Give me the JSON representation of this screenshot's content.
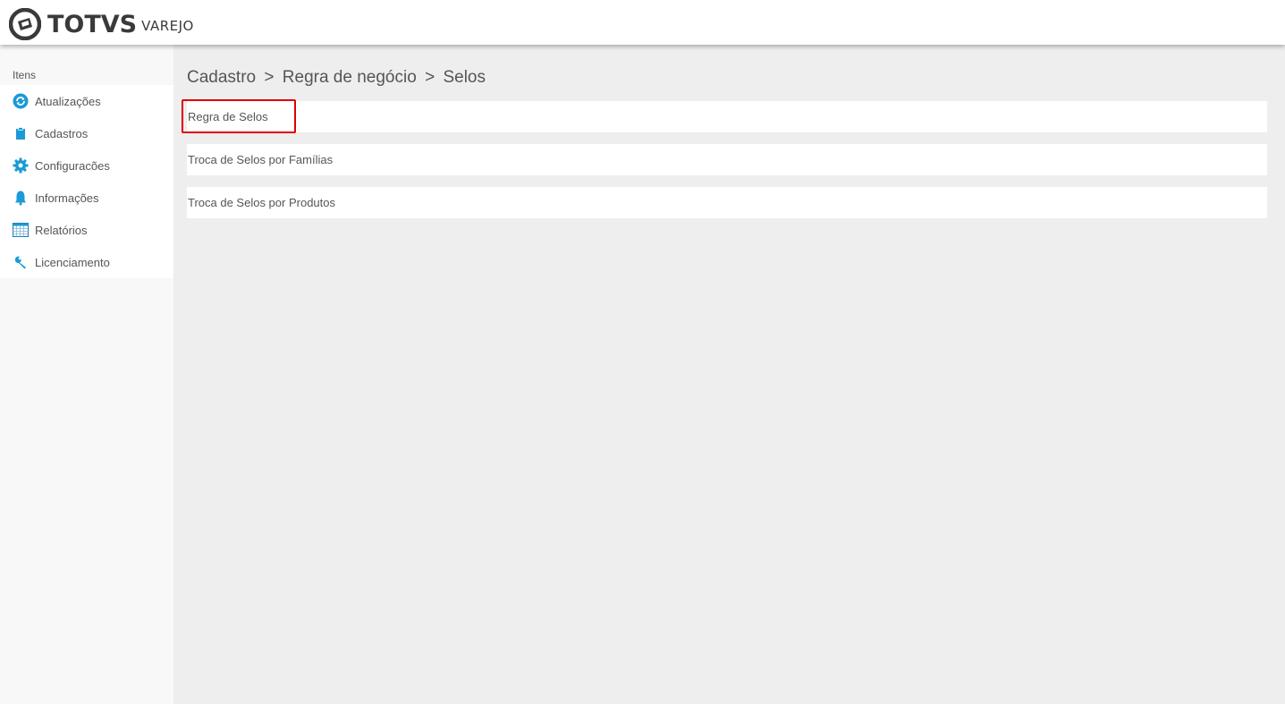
{
  "header": {
    "brand": "TOTVS",
    "product": "VAREJO"
  },
  "sidebar": {
    "title": "Itens",
    "items": [
      {
        "label": "Atualizações",
        "icon": "refresh-icon"
      },
      {
        "label": "Cadastros",
        "icon": "clipboard-icon"
      },
      {
        "label": "Configuracões",
        "icon": "gear-icon"
      },
      {
        "label": "Informações",
        "icon": "bell-icon"
      },
      {
        "label": "Relatórios",
        "icon": "table-icon"
      },
      {
        "label": "Licenciamento",
        "icon": "wrench-icon"
      }
    ]
  },
  "breadcrumb": {
    "items": [
      "Cadastro",
      "Regra de negócio",
      "Selos"
    ],
    "separator": ">"
  },
  "menu": {
    "items": [
      {
        "label": "Regra de Selos",
        "highlighted": true
      },
      {
        "label": "Troca de Selos por Famílias"
      },
      {
        "label": "Troca de Selos por Produtos"
      }
    ]
  },
  "colors": {
    "accent": "#1a9ad6",
    "highlight": "#e00000",
    "content_bg": "#eeeeee"
  }
}
